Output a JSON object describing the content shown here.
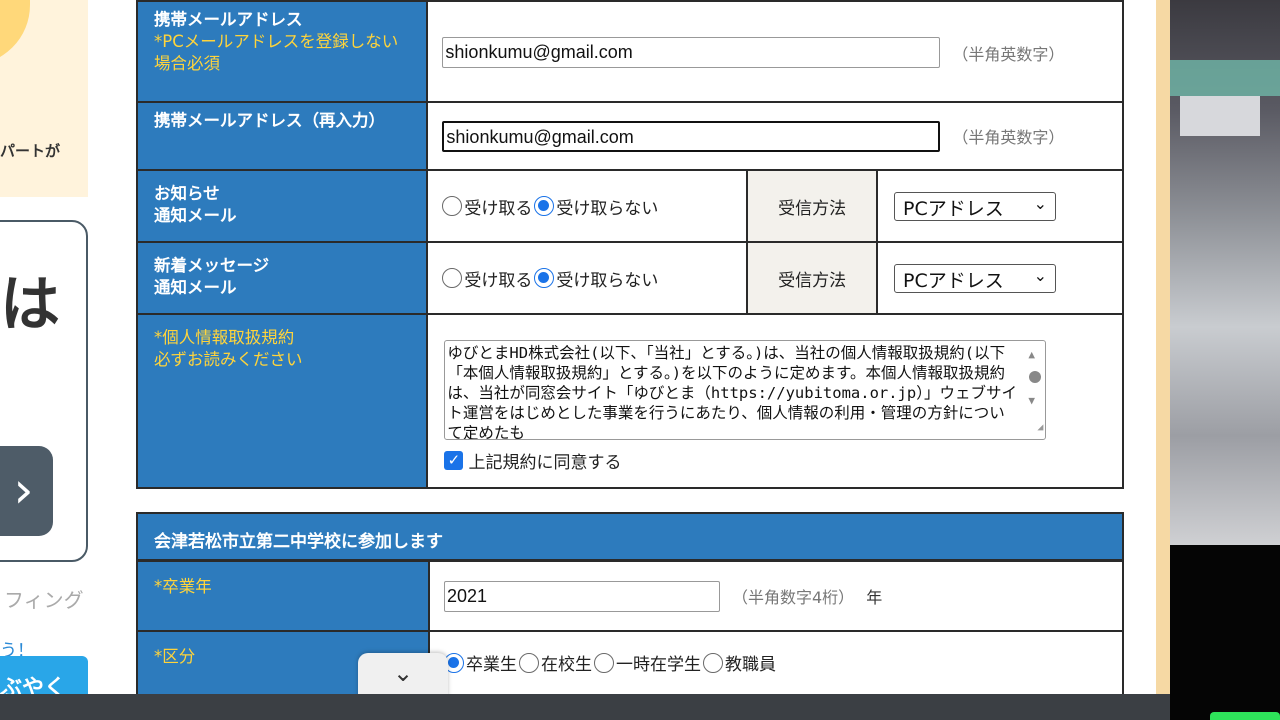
{
  "sidebar": {
    "promo_text": "パートが",
    "card_char": "は",
    "card_arrow": "›",
    "text1": "フィング",
    "text2": "う！",
    "button_label": "ぶやく"
  },
  "form": {
    "mobile_email": {
      "label": "携帯メールアドレス",
      "note": "*PCメールアドレスを登録しない場合必須",
      "value": "shionkumu@gmail.com",
      "hint": "（半角英数字）"
    },
    "mobile_email_confirm": {
      "label": "携帯メールアドレス（再入力）",
      "value": "shionkumu@gmail.com",
      "hint": "（半角英数字）"
    },
    "notice_mail": {
      "label_line1": "お知らせ",
      "label_line2": "通知メール",
      "option_receive": "受け取る",
      "option_not_receive": "受け取らない",
      "selected": "受け取らない",
      "method_label": "受信方法",
      "method_value": "PCアドレス"
    },
    "message_mail": {
      "label_line1": "新着メッセージ",
      "label_line2": "通知メール",
      "option_receive": "受け取る",
      "option_not_receive": "受け取らない",
      "selected": "受け取らない",
      "method_label": "受信方法",
      "method_value": "PCアドレス"
    },
    "privacy": {
      "label": "*個人情報取扱規約",
      "note": "必ずお読みください",
      "text": "ゆびとまHD株式会社(以下、「当社」とする。)は、当社の個人情報取扱規約(以下「本個人情報取扱規約」とする。)を以下のように定めます。本個人情報取扱規約は、当社が同窓会サイト「ゆびとま（https://yubitoma.or.jp）」ウェブサイト運営をはじめとした事業を行うにあたり、個人情報の利用・管理の方針について定めたも",
      "agree_label": "上記規約に同意する",
      "agreed": true
    }
  },
  "school_section": {
    "title": "会津若松市立第二中学校に参加します",
    "grad_year": {
      "label": "*卒業年",
      "value": "2021",
      "hint": "（半角数字4桁）",
      "unit": "年"
    },
    "category": {
      "label": "*区分",
      "options": [
        "卒業生",
        "在校生",
        "一時在学生",
        "教職員"
      ],
      "selected": "卒業生"
    }
  },
  "scroll_button": "⌄"
}
